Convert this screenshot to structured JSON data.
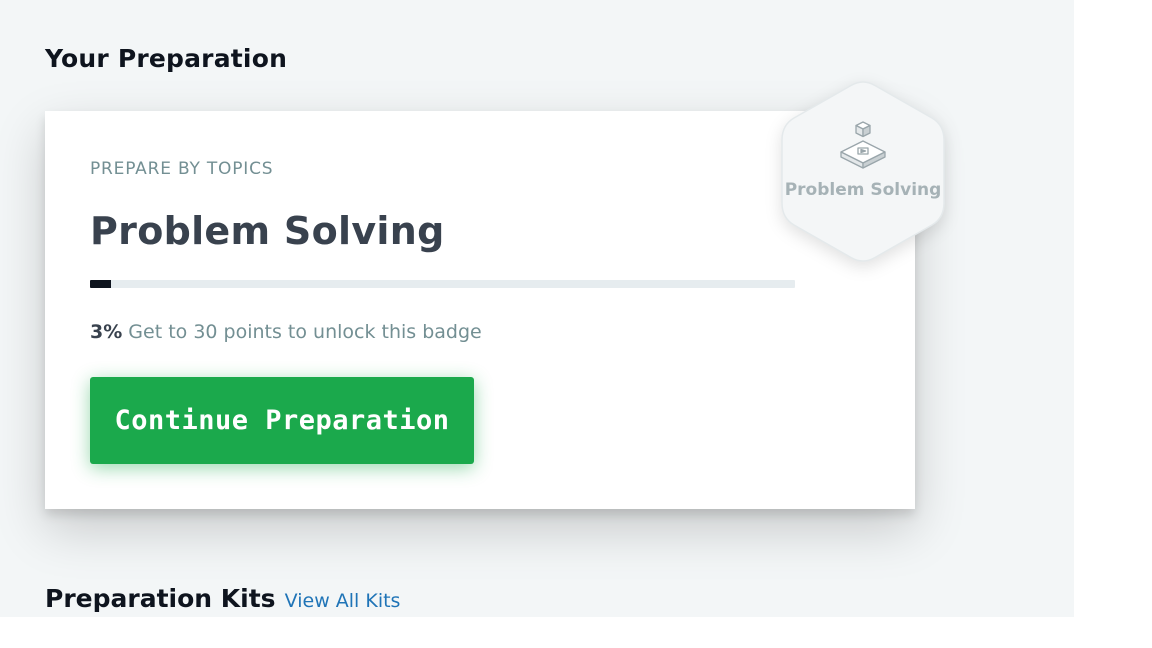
{
  "page": {
    "section_title": "Your Preparation"
  },
  "card": {
    "eyebrow": "PREPARE BY TOPICS",
    "title": "Problem Solving",
    "progress": {
      "percent": 3,
      "percent_label": "3%",
      "message": " Get to 30 points to unlock this badge"
    },
    "button_label": "Continue Preparation"
  },
  "badge": {
    "label": "Problem Solving",
    "icon": "isometric-blocks-icon"
  },
  "kits": {
    "title": "Preparation Kits",
    "link_label": "View All Kits"
  },
  "colors": {
    "background": "#f3f6f7",
    "button": "#1ba94c",
    "progress_fill": "#0e141e",
    "progress_track": "#e6ecef",
    "link": "#1f74b7"
  }
}
